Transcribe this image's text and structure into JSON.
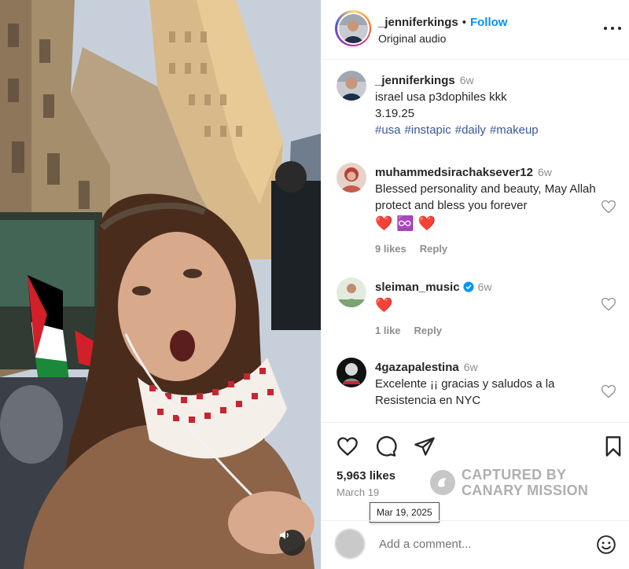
{
  "post": {
    "username": "_jenniferkings",
    "separator": "•",
    "follow_label": "Follow",
    "audio": "Original audio"
  },
  "caption": {
    "username": "_jenniferkings",
    "time": "6w",
    "line1": "israel usa p3dophiles kkk",
    "line2": "3.19.25",
    "hashtags": [
      "#usa",
      "#instapic",
      "#daily",
      "#makeup"
    ]
  },
  "comments": [
    {
      "username": "muhammedsirachaksever12",
      "time": "6w",
      "text": "Blessed personality and beauty, May Allah protect and bless you forever",
      "emojis": "❤️ ♾️ ❤️",
      "likes": "9 likes",
      "reply": "Reply"
    },
    {
      "username": "sleiman_music",
      "time": "6w",
      "verified": true,
      "emojis": "❤️",
      "likes": "1 like",
      "reply": "Reply"
    },
    {
      "username": "4gazapalestina",
      "time": "6w",
      "text": "Excelente ¡¡ gracias y saludos a la Resistencia en NYC"
    }
  ],
  "actions": {
    "icons": [
      "heart-icon",
      "comment-icon",
      "share-icon",
      "bookmark-icon"
    ],
    "likes": "5,963 likes",
    "date": "March 19",
    "tooltip": "Mar 19, 2025"
  },
  "watermark": {
    "line1": "CAPTURED BY",
    "line2": "CANARY MISSION"
  },
  "add_comment": {
    "placeholder": "Add a comment..."
  },
  "colors": {
    "link": "#0095f6",
    "hashtag": "#385898",
    "muted": "#8e8e8e",
    "heart": "#e0245e",
    "verified": "#0095f6"
  }
}
